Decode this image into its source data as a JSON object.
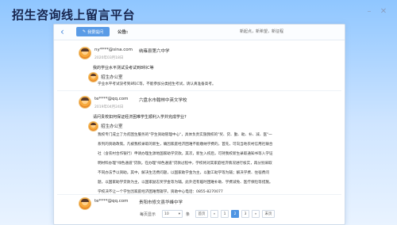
{
  "app": {
    "title": "招生咨询线上留言平台"
  },
  "toolbar": {
    "back_label": "‹",
    "ask_label": "我要提问",
    "notice_label": "公告:",
    "notice_text": "新起点，新希望，新征程"
  },
  "messages": [
    {
      "user": "ny****@sina.com",
      "school": "纳雍县第六中学",
      "date": "2020年03月18日",
      "question": "我的学业水平测试没考试到8科C等",
      "office": "招生办公室",
      "reply": [
        "学业水平考试没考到8科C等，不能参加分类招生考试，请认真准备高考。"
      ]
    },
    {
      "user": "te****@qq.com",
      "school": "六盘水市翰林中英文学校",
      "date": "2019年04月24日",
      "question": "请问贵校如何保证经济困难学生顺利入学并完成学业?",
      "office": "招生办公室",
      "reply": [
        "我校专门成立了为贫困生服务的\"学生资助管理中心\"，具体负责实施我校的\"奖、贷、勤、助、补、减、医\"一",
        "系列的资助政策。凡被我校录取的新生，确因家庭经济困难不能缴纳学费的，首先，可向当地农村信用社联合",
        "社（含农村合作银行）申请办理生源地国家助学贷款。其次，新生入校后，可持我校新生录取通知书等入学证",
        "明材料办理\"绿色通道\"贷款。在办理\"绿色通道\"贷款过程中，学校将对其家庭经济情况进行核实，再分别采取",
        "不同办法予以资助。其中，解决生活费问题，以国家助学金为主，以勤工助学等为辅；解决学费、住宿费问",
        "题，以国家助学贷款为主，以国家励志奖学金等为辅。此外还有临时困难补助、学费减免、医疗保险等措施。",
        "学校决不让一个学生因家庭经济困难而辍学。资助中心电话：0855-8270077"
      ]
    },
    {
      "user": "te****@qq.com",
      "school": "贵阳市修文县华峰中学",
      "date": "",
      "question": "",
      "office": "",
      "reply": []
    }
  ],
  "pager": {
    "per_page_label": "每页显示",
    "per_page_value": "10",
    "unit_label": "条",
    "first": "首页",
    "prev": "«",
    "pages": [
      "1",
      "2",
      "3"
    ],
    "current_page": "2",
    "next": "»",
    "last": "末页"
  },
  "colors": {
    "accent": "#4f95e3",
    "title": "#17254e"
  }
}
